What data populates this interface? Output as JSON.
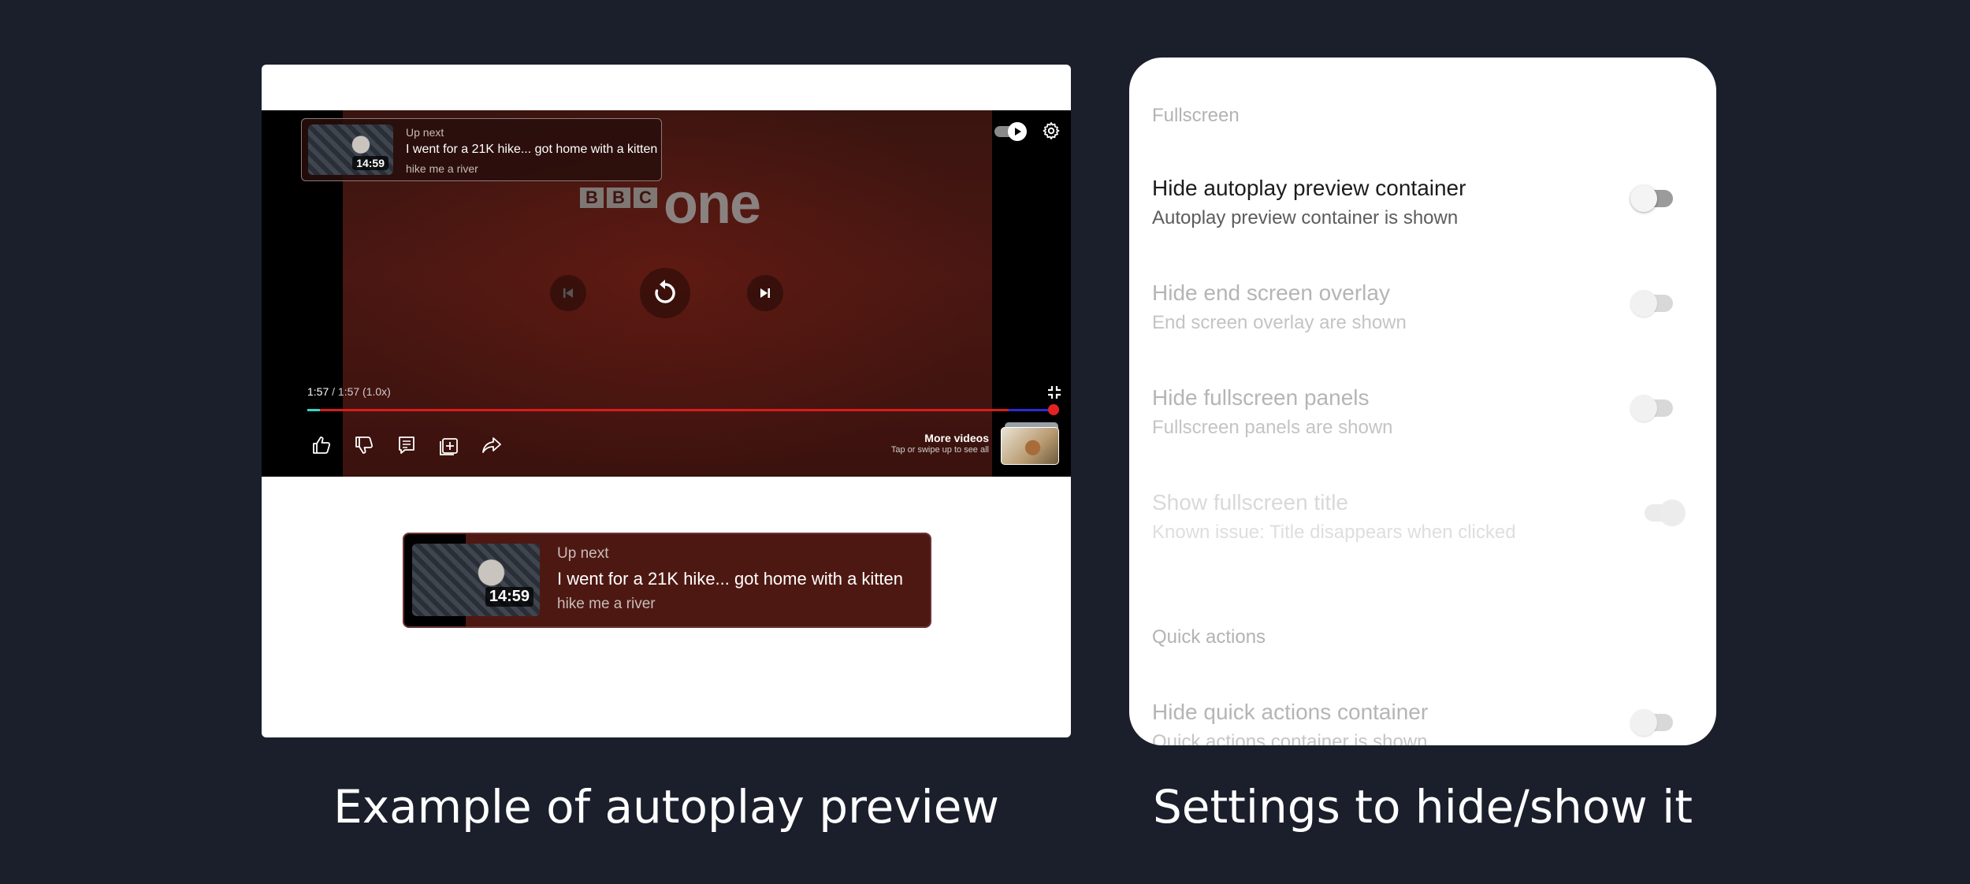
{
  "example": {
    "player": {
      "channel_logo": {
        "letters": [
          "B",
          "B",
          "C"
        ],
        "word": "one"
      },
      "up_next_small": {
        "label": "Up next",
        "title": "I went for a 21K hike... got home with a kitten",
        "channel": "hike me a river",
        "duration": "14:59"
      },
      "time": {
        "current": "1:57",
        "separator": " / ",
        "total": "1:57",
        "speed": " (1.0x)"
      },
      "progress": 1.0,
      "more_videos": {
        "title": "More videos",
        "subtitle": "Tap or swipe up to see all"
      },
      "icons": [
        "autoplay-toggle-icon",
        "gear-icon",
        "previous-icon",
        "replay-icon",
        "next-icon",
        "exit-fullscreen-icon",
        "like-icon",
        "dislike-icon",
        "comments-icon",
        "save-playlist-icon",
        "share-icon"
      ]
    },
    "up_next_large": {
      "label": "Up next",
      "title": "I went for a 21K hike... got home with a kitten",
      "channel": "hike me a river",
      "duration": "14:59"
    }
  },
  "settings": {
    "section_fullscreen": "Fullscreen",
    "items": [
      {
        "title": "Hide autoplay preview container",
        "subtitle": "Autoplay preview container is shown",
        "enabled": false
      },
      {
        "title": "Hide end screen overlay",
        "subtitle": "End screen overlay are shown",
        "enabled": false
      },
      {
        "title": "Hide fullscreen panels",
        "subtitle": "Fullscreen panels are shown",
        "enabled": false
      },
      {
        "title": "Show fullscreen title",
        "subtitle": "Known issue: Title disappears when clicked",
        "enabled": true
      }
    ],
    "section_quick_actions": "Quick actions",
    "quick_items": [
      {
        "title": "Hide quick actions container",
        "subtitle": "Quick actions container is shown",
        "enabled": false
      }
    ]
  },
  "captions": {
    "left": "Example of autoplay preview",
    "right": "Settings to hide/show it"
  },
  "colors": {
    "page_background": "#1b1f2c",
    "player_red": "#4a1712",
    "progress_red": "#d91c1c",
    "card_white": "#ffffff"
  }
}
